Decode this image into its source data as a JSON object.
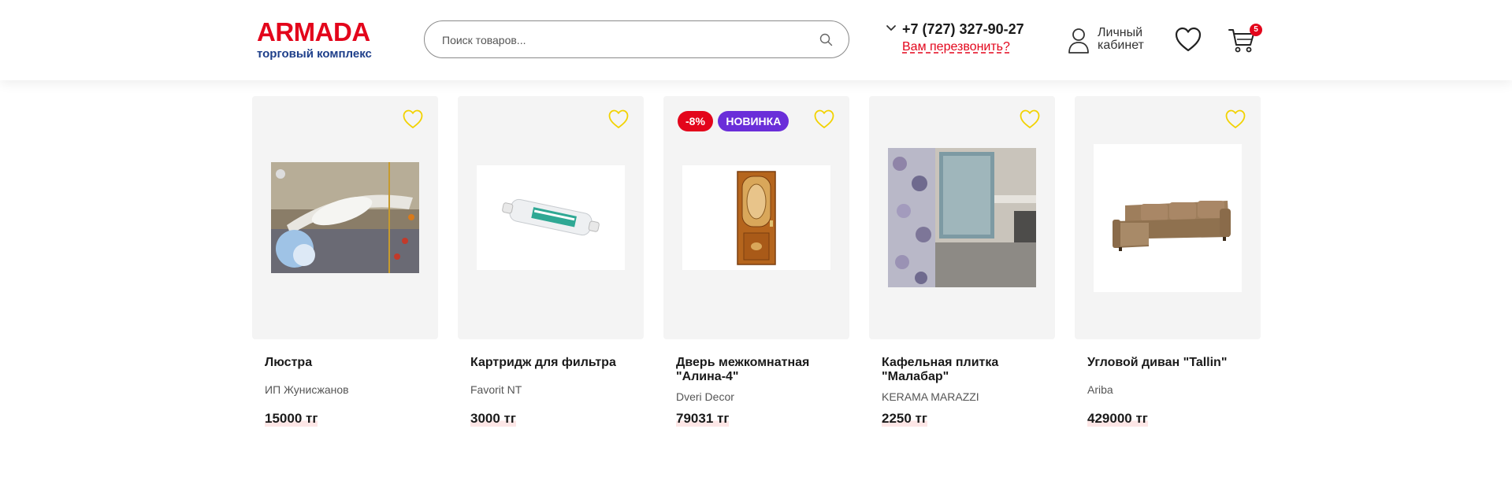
{
  "header": {
    "logo_main": "ARMADA",
    "logo_sub": "торговый комплекс",
    "search_placeholder": "Поиск товаров...",
    "phone": "+7 (727) 327-90-27",
    "callback_label": "Вам перезвонить?",
    "account_label": "Личный кабинет",
    "cart_count": "5"
  },
  "products": [
    {
      "name": "Люстра",
      "brand": "ИП Жунисжанов",
      "price": "15000 тг",
      "badges": []
    },
    {
      "name": "Картридж для фильтра",
      "brand": "Favorit NT",
      "price": "3000 тг",
      "badges": []
    },
    {
      "name": "Дверь межкомнатная \"Алина-4\"",
      "brand": "Dveri Decor",
      "price": "79031 тг",
      "badges": [
        "-8%",
        "НОВИНКА"
      ]
    },
    {
      "name": "Кафельная плитка \"Малабар\"",
      "brand": "KERAMA MARAZZI",
      "price": "2250 тг",
      "badges": []
    },
    {
      "name": "Угловой диван \"Tallin\"",
      "brand": "Ariba",
      "price": "429000 тг",
      "badges": []
    }
  ],
  "colors": {
    "brand_red": "#e3051b",
    "brand_blue": "#1e3f8a",
    "new_badge": "#6a2ed9",
    "heart_outline": "#f2d200",
    "card_bg": "#f4f4f4"
  },
  "icons": [
    "search-icon",
    "chevron-down-icon",
    "user-icon",
    "heart-icon",
    "cart-icon"
  ]
}
